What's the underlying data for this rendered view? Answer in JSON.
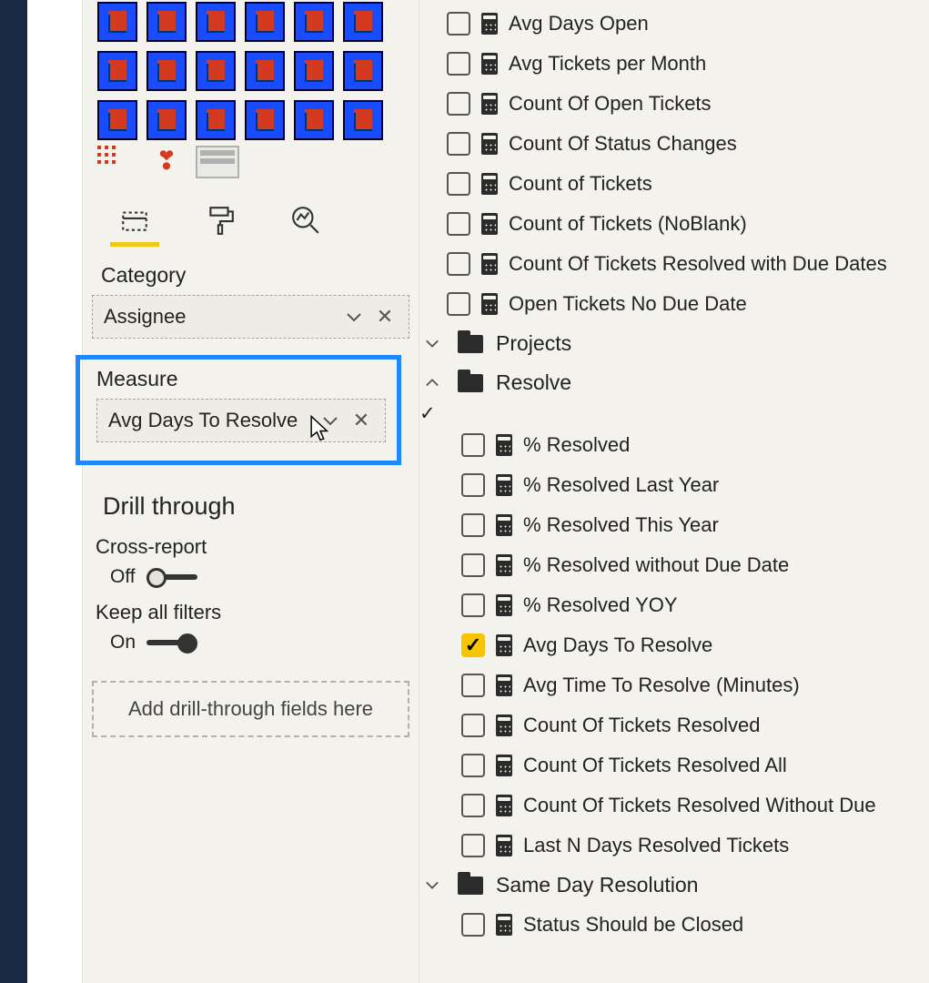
{
  "viz": {
    "tile_count": 18
  },
  "wells": {
    "category_label": "Category",
    "category_field": "Assignee",
    "measure_label": "Measure",
    "measure_field": "Avg Days To Resolve"
  },
  "drill": {
    "title": "Drill through",
    "cross_label": "Cross-report",
    "cross_state": "Off",
    "keep_label": "Keep all filters",
    "keep_state": "On",
    "drop_placeholder": "Add drill-through fields here"
  },
  "fields": {
    "group1": [
      "Avg Days Open",
      "Avg Tickets per Month",
      "Count Of Open Tickets",
      "Count Of Status Changes",
      "Count of Tickets",
      "Count of Tickets (NoBlank)",
      "Count Of Tickets Resolved with Due Dates",
      "Open Tickets No Due Date"
    ],
    "folder_projects": "Projects",
    "folder_resolve": "Resolve",
    "resolve_items": [
      {
        "label": "% Resolved",
        "checked": false
      },
      {
        "label": "% Resolved Last Year",
        "checked": false
      },
      {
        "label": "% Resolved This Year",
        "checked": false
      },
      {
        "label": "% Resolved without Due Date",
        "checked": false
      },
      {
        "label": "% Resolved YOY",
        "checked": false
      },
      {
        "label": "Avg Days To Resolve",
        "checked": true
      },
      {
        "label": "Avg Time To Resolve (Minutes)",
        "checked": false
      },
      {
        "label": "Count Of Tickets Resolved",
        "checked": false
      },
      {
        "label": "Count Of Tickets Resolved All",
        "checked": false
      },
      {
        "label": "Count Of Tickets Resolved Without Due",
        "checked": false
      },
      {
        "label": "Last N Days Resolved Tickets",
        "checked": false
      }
    ],
    "folder_sameday": "Same Day Resolution",
    "sameday_items": [
      {
        "label": "Status Should be Closed",
        "checked": false
      }
    ]
  }
}
